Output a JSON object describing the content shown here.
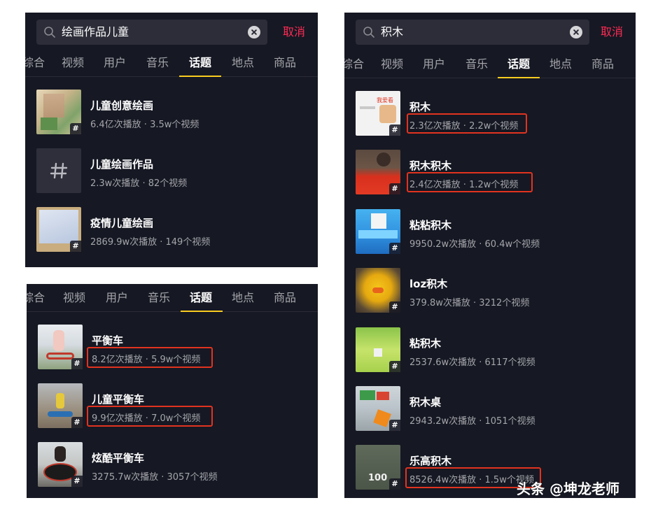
{
  "panel1": {
    "search": {
      "query": "绘画作品儿童",
      "cancel_label": "取消"
    },
    "tabs": [
      "综合",
      "视频",
      "用户",
      "音乐",
      "话题",
      "地点",
      "商品"
    ],
    "active_tab": "话题",
    "items": [
      {
        "title": "儿童创意绘画",
        "stats": "6.4亿次播放 · 3.5w个视频"
      },
      {
        "title": "儿童绘画作品",
        "stats": "2.3w次播放 · 82个视频"
      },
      {
        "title": "疫情儿童绘画",
        "stats": "2869.9w次播放 · 149个视频"
      }
    ]
  },
  "panel2": {
    "tabs": [
      "综合",
      "视频",
      "用户",
      "音乐",
      "话题",
      "地点",
      "商品"
    ],
    "active_tab": "话题",
    "items": [
      {
        "title": "平衡车",
        "stats": "8.2亿次播放 · 5.9w个视频"
      },
      {
        "title": "儿童平衡车",
        "stats": "9.9亿次播放 · 7.0w个视频"
      },
      {
        "title": "炫酷平衡车",
        "stats": "3275.7w次播放 · 3057个视频"
      }
    ]
  },
  "panel3": {
    "search": {
      "query": "积木",
      "cancel_label": "取消"
    },
    "tabs": [
      "综合",
      "视频",
      "用户",
      "音乐",
      "话题",
      "地点",
      "商品"
    ],
    "active_tab": "话题",
    "items": [
      {
        "title": "积木",
        "stats": "2.3亿次播放 · 2.2w个视频",
        "thumb_text": "我爱看"
      },
      {
        "title": "积木积木",
        "stats": "2.4亿次播放 · 1.2w个视频"
      },
      {
        "title": "粘粘积木",
        "stats": "9950.2w次播放 · 60.4w个视频"
      },
      {
        "title": "loz积木",
        "stats": "379.8w次播放 · 3212个视频"
      },
      {
        "title": "粘积木",
        "stats": "2537.6w次播放 · 6117个视频"
      },
      {
        "title": "积木桌",
        "stats": "2943.2w次播放 · 1051个视频"
      },
      {
        "title": "乐高积木",
        "stats": "8526.4w次播放 · 1.5w个视频",
        "thumb_text": "100"
      }
    ]
  },
  "hash_symbol": "#",
  "watermark": "头条 @坤龙老师",
  "colors": {
    "background": "#161823",
    "accent": "#fe2c55",
    "tab_underline": "#facc20",
    "highlight_border": "#e2331f"
  },
  "icons": {
    "search": "search-icon",
    "clear": "clear-icon",
    "hashtag": "hashtag-icon"
  }
}
